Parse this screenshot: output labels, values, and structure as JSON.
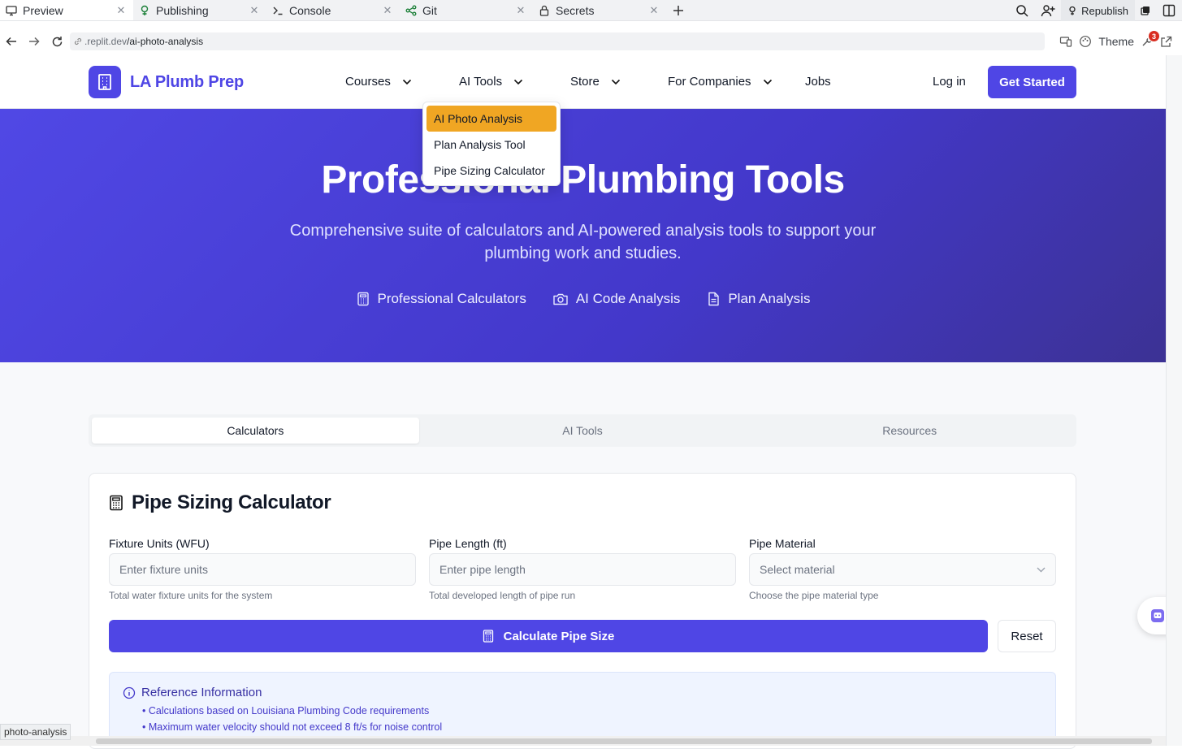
{
  "workspace_tabs": [
    {
      "label": "Preview",
      "icon": "monitor-icon"
    },
    {
      "label": "Publishing",
      "icon": "publish-icon"
    },
    {
      "label": "Console",
      "icon": "terminal-icon"
    },
    {
      "label": "Git",
      "icon": "git-icon"
    },
    {
      "label": "Secrets",
      "icon": "lock-icon"
    }
  ],
  "republish_label": "Republish",
  "address": {
    "domain": ".replit.dev",
    "path": "/ai-photo-analysis"
  },
  "theme_label": "Theme",
  "notification_count": "3",
  "site": {
    "brand": "LA Plumb Prep",
    "nav": [
      "Courses",
      "AI Tools",
      "Store",
      "For Companies",
      "Jobs"
    ],
    "login": "Log in",
    "cta": "Get Started",
    "accent": "#4f46e5",
    "highlight": "#f0a623"
  },
  "dropdown": {
    "items": [
      "AI Photo Analysis",
      "Plan Analysis Tool",
      "Pipe Sizing Calculator"
    ],
    "active_index": 0
  },
  "hero": {
    "title": "Professional Plumbing Tools",
    "subtitle": "Comprehensive suite of calculators and AI-powered analysis tools to support your plumbing work and studies.",
    "features": [
      "Professional Calculators",
      "AI Code Analysis",
      "Plan Analysis"
    ]
  },
  "tabs": [
    "Calculators",
    "AI Tools",
    "Resources"
  ],
  "calculator": {
    "title": "Pipe Sizing Calculator",
    "fields": [
      {
        "label": "Fixture Units (WFU)",
        "placeholder": "Enter fixture units",
        "hint": "Total water fixture units for the system"
      },
      {
        "label": "Pipe Length (ft)",
        "placeholder": "Enter pipe length",
        "hint": "Total developed length of pipe run"
      },
      {
        "label": "Pipe Material",
        "placeholder": "Select material",
        "hint": "Choose the pipe material type"
      }
    ],
    "calculate_label": "Calculate Pipe Size",
    "reset_label": "Reset",
    "reference": {
      "title": "Reference Information",
      "items": [
        "• Calculations based on Louisiana Plumbing Code requirements",
        "• Maximum water velocity should not exceed 8 ft/s for noise control"
      ]
    }
  },
  "status_url": "photo-analysis"
}
